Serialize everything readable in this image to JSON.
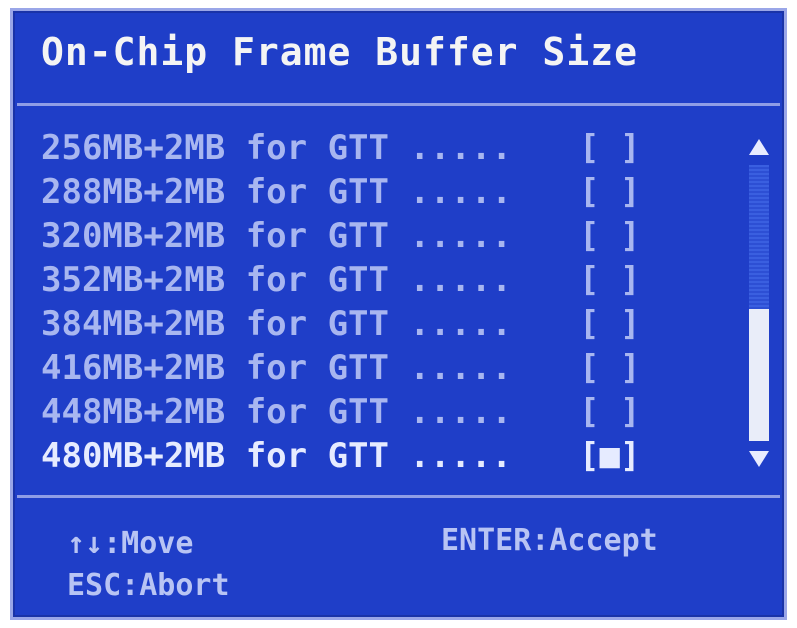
{
  "dialog": {
    "title": "On-Chip Frame Buffer Size"
  },
  "options": [
    {
      "label": "256MB+2MB for GTT .....",
      "box": "[ ]",
      "selected": false
    },
    {
      "label": "288MB+2MB for GTT .....",
      "box": "[ ]",
      "selected": false
    },
    {
      "label": "320MB+2MB for GTT .....",
      "box": "[ ]",
      "selected": false
    },
    {
      "label": "352MB+2MB for GTT .....",
      "box": "[ ]",
      "selected": false
    },
    {
      "label": "384MB+2MB for GTT .....",
      "box": "[ ]",
      "selected": false
    },
    {
      "label": "416MB+2MB for GTT .....",
      "box": "[ ]",
      "selected": false
    },
    {
      "label": "448MB+2MB for GTT .....",
      "box": "[ ]",
      "selected": false
    },
    {
      "label": "480MB+2MB for GTT .....",
      "box": "[■]",
      "selected": true
    }
  ],
  "scrollbar": {
    "up_icon": "arrow-up-icon",
    "down_icon": "arrow-down-icon",
    "thumb_fraction": 0.48
  },
  "footer": {
    "move": "↑↓:Move",
    "accept": "ENTER:Accept",
    "abort": "ESC:Abort"
  },
  "colors": {
    "background": "#1f3ec8",
    "text": "#f4f4f4",
    "border": "#9aa6e8"
  }
}
